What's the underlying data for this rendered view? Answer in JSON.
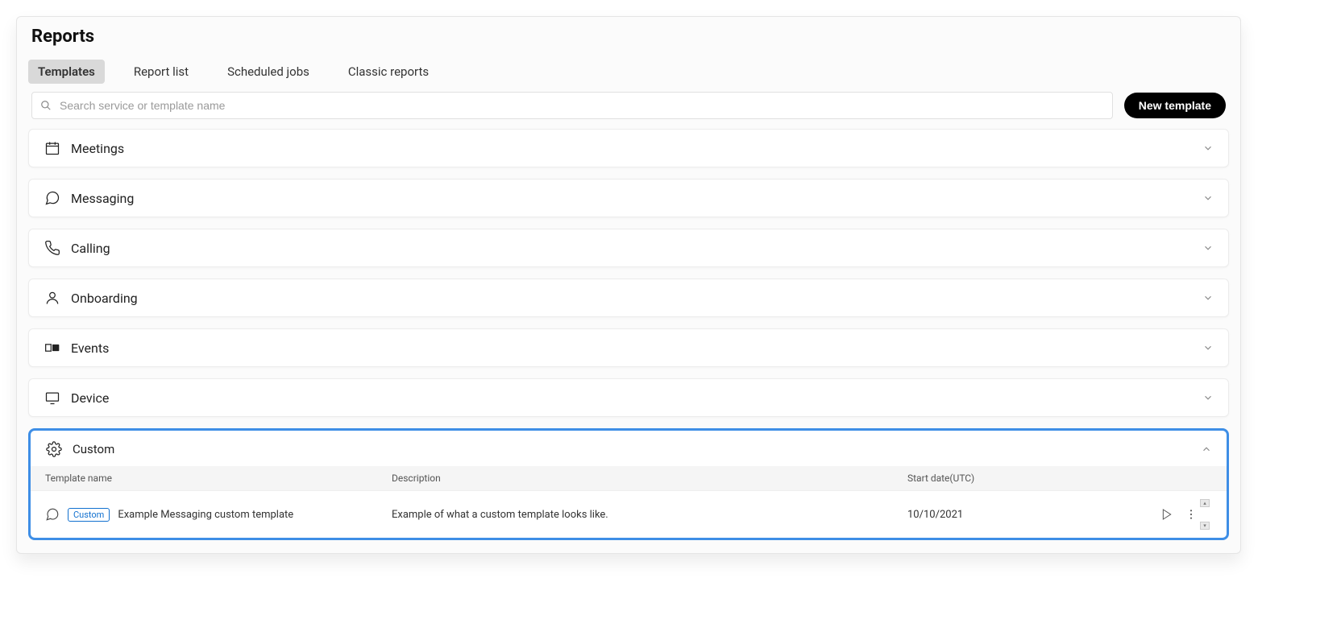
{
  "page": {
    "title": "Reports"
  },
  "tabs": [
    {
      "label": "Templates",
      "active": true
    },
    {
      "label": "Report list",
      "active": false
    },
    {
      "label": "Scheduled jobs",
      "active": false
    },
    {
      "label": "Classic reports",
      "active": false
    }
  ],
  "search": {
    "placeholder": "Search service or template name"
  },
  "new_button": {
    "label": "New template"
  },
  "categories": [
    {
      "icon": "calendar",
      "label": "Meetings"
    },
    {
      "icon": "chat",
      "label": "Messaging"
    },
    {
      "icon": "phone",
      "label": "Calling"
    },
    {
      "icon": "user",
      "label": "Onboarding"
    },
    {
      "icon": "ticket",
      "label": "Events"
    },
    {
      "icon": "device",
      "label": "Device"
    }
  ],
  "custom": {
    "section_label": "Custom",
    "columns": {
      "name": "Template name",
      "desc": "Description",
      "date": "Start date(UTC)"
    },
    "rows": [
      {
        "badge": "Custom",
        "name": "Example Messaging custom template",
        "desc": "Example of what a custom template looks like.",
        "date": "10/10/2021"
      }
    ]
  }
}
